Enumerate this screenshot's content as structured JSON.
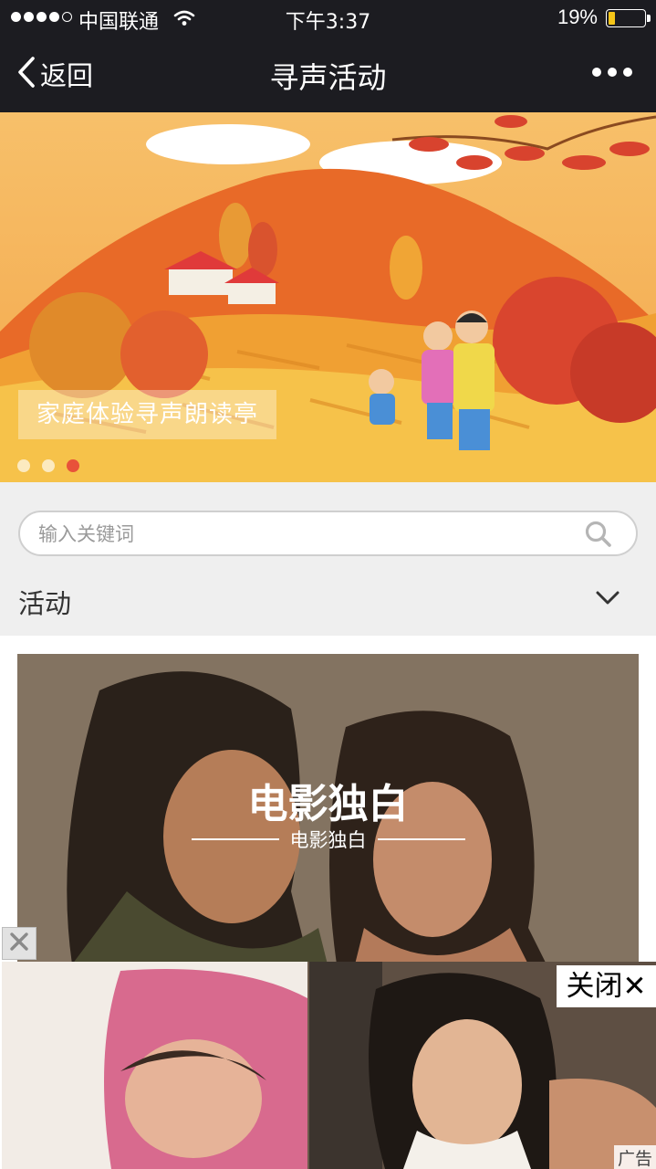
{
  "status_bar": {
    "carrier": "中国联通",
    "time": "下午3:37",
    "battery_percent": "19%",
    "battery_level": 0.19,
    "battery_color": "#f5c518"
  },
  "nav": {
    "back_label": "返回",
    "title": "寻声活动",
    "more_icon": "ellipsis-icon"
  },
  "banner": {
    "caption": "家庭体验寻声朗读亭",
    "slide_count": 3,
    "active_slide": 3,
    "active_dot_color": "#e8523a"
  },
  "search": {
    "placeholder": "输入关键词",
    "value": ""
  },
  "category": {
    "selected": "活动"
  },
  "card": {
    "title": "电影独白",
    "subtitle": "电影独白"
  },
  "ad": {
    "close_label": "关闭✕",
    "small_close_icon": "close-icon",
    "label": "广告"
  }
}
